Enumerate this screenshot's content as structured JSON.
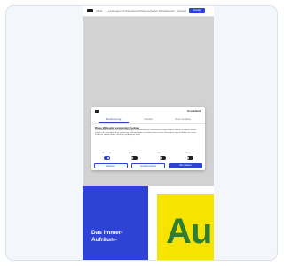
{
  "nav": {
    "items": [
      "Inhalt",
      "Leistungen",
      "Anwendungen",
      "Partnerschaften",
      "Einstellungen",
      "Kontakt"
    ],
    "cta_label": "Kontakt"
  },
  "consent": {
    "logo_text": "Cookiebot",
    "close_symbol": "×",
    "tabs": [
      "Zustimmung",
      "Details",
      "Über Cookies"
    ],
    "heading": "Diese Webseite verwendet Cookies",
    "body": "Wir verwenden Cookies, um Inhalte und Anzeigen zu personalisieren, Funktionen für soziale Medien anbieten zu können und die Zugriffe auf unsere Website zu analysieren. Außerdem geben wir Informationen zu Ihrer Verwendung unserer Website an unsere Partner für soziale Medien, Werbung und Analysen weiter.",
    "toggles": [
      {
        "label": "Notwendig",
        "on": true
      },
      {
        "label": "Präferenzen",
        "on": false
      },
      {
        "label": "Statistiken",
        "on": false
      },
      {
        "label": "Marketing",
        "on": false
      }
    ],
    "buttons": {
      "deny": "Ablehnen",
      "select": "Auswahl erlauben",
      "allow_all": "Alle zulassen"
    }
  },
  "hero": {
    "headline": "Das Immer-Aufräum-",
    "big_text": "Au"
  },
  "colors": {
    "brand_blue": "#2e43d6",
    "yellow": "#f6e400",
    "green": "#2f7d32"
  }
}
